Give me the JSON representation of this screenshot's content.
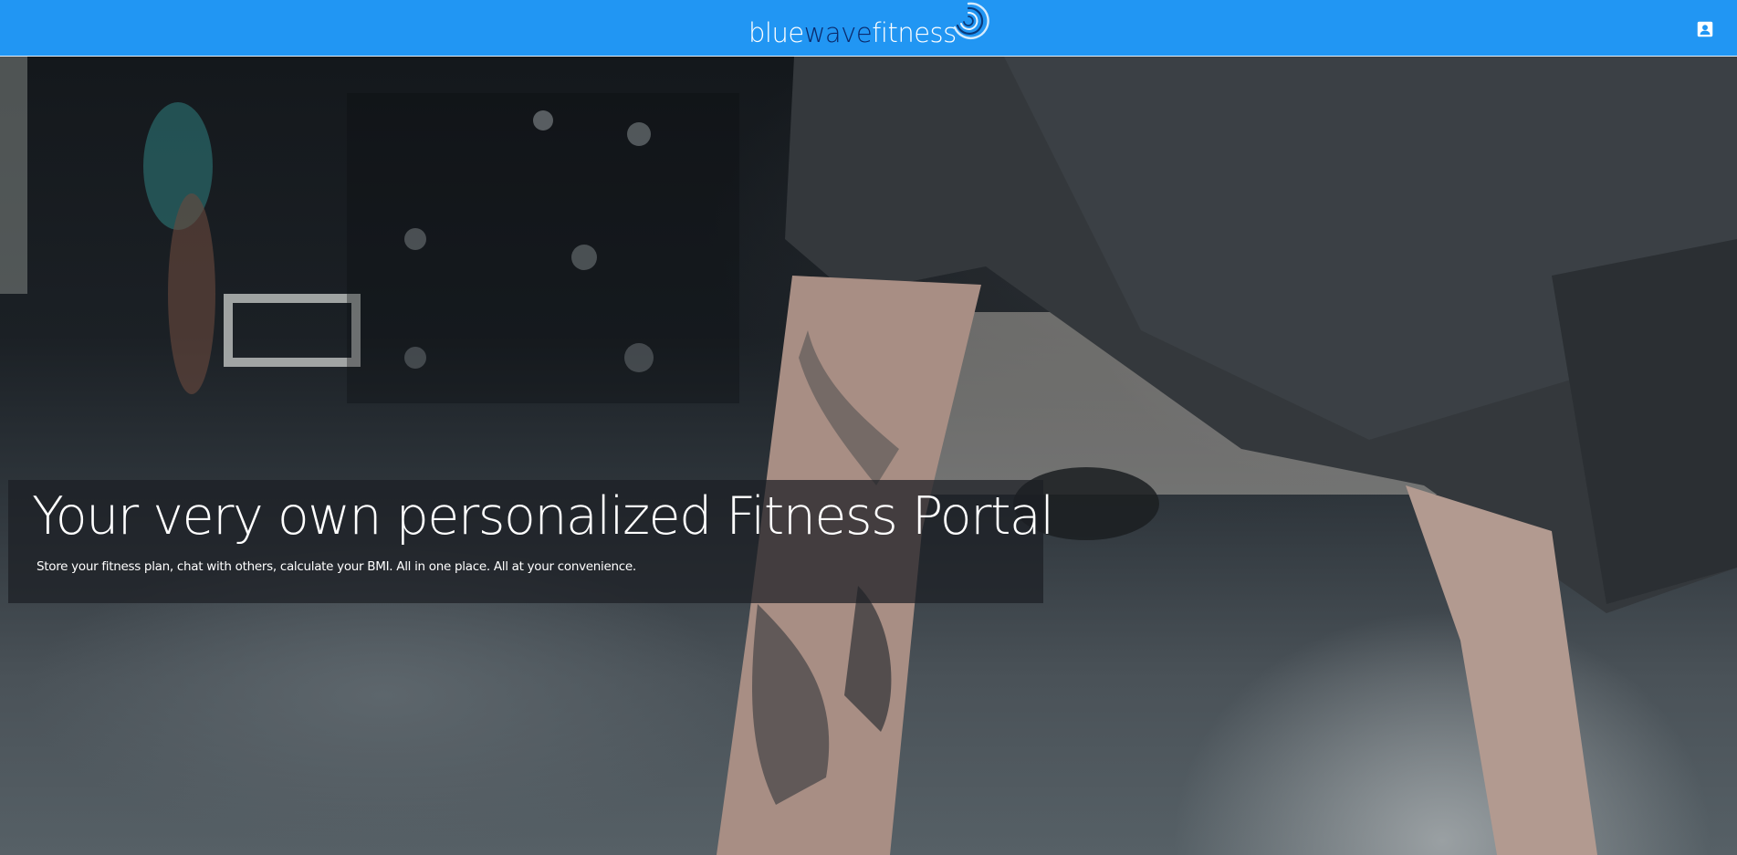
{
  "navbar": {
    "brand_part1": "blue",
    "brand_part2": "wave",
    "brand_part3": "fitness",
    "brand_logo_icon": "wave-swirl-logo",
    "account_icon": "account-box-icon",
    "colors": {
      "bar": "#2196f3",
      "brand_accent": "#0b2a6b",
      "text": "#ffffff"
    }
  },
  "hero": {
    "background_image": "gym-workout-photo",
    "title": "Your very own personalized Fitness Portal",
    "subtitle": "Store your fitness plan, chat with others, calculate your BMI. All in one place. All at your convenience."
  }
}
